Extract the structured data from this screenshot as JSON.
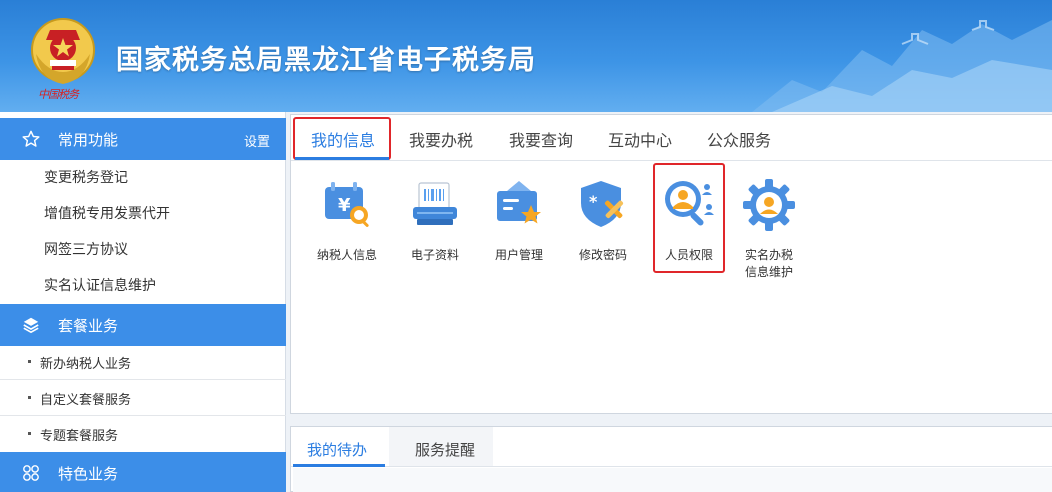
{
  "header": {
    "site_title": "国家税务总局黑龙江省电子税务局",
    "emblem_text": "中国税务"
  },
  "sidebar": {
    "common": {
      "title": "常用功能",
      "setting_label": "设置",
      "items": [
        "变更税务登记",
        "增值税专用发票代开",
        "网签三方协议",
        "实名认证信息维护"
      ]
    },
    "package": {
      "title": "套餐业务",
      "items": [
        "新办纳税人业务",
        "自定义套餐服务",
        "专题套餐服务"
      ]
    },
    "special": {
      "title": "特色业务"
    }
  },
  "main": {
    "tabs": [
      {
        "label": "我的信息",
        "active": true
      },
      {
        "label": "我要办税",
        "active": false
      },
      {
        "label": "我要查询",
        "active": false
      },
      {
        "label": "互动中心",
        "active": false
      },
      {
        "label": "公众服务",
        "active": false
      }
    ],
    "tiles": [
      {
        "label": "纳税人信息",
        "icon": "taxpayer-info-icon"
      },
      {
        "label": "电子资料",
        "icon": "electronic-data-icon"
      },
      {
        "label": "用户管理",
        "icon": "user-management-icon"
      },
      {
        "label": "修改密码",
        "icon": "change-password-icon"
      },
      {
        "label": "人员权限",
        "icon": "personnel-permission-icon",
        "highlighted": true
      },
      {
        "label": "实名办税信息维护",
        "label_line1": "实名办税",
        "label_line2": "信息维护",
        "icon": "realname-info-icon"
      }
    ]
  },
  "lower": {
    "tabs": [
      {
        "label": "我的待办",
        "active": true
      },
      {
        "label": "服务提醒",
        "active": false
      }
    ]
  },
  "colors": {
    "accent": "#2b7de1",
    "sidebar_header": "#3c8ee8",
    "highlight_border": "#e0262a",
    "header_top": "#2a7fd6"
  }
}
